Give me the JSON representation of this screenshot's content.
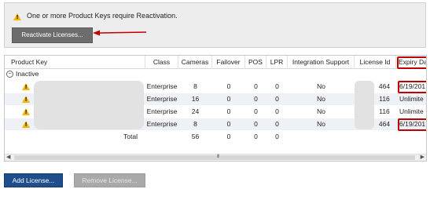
{
  "notice": {
    "message": "One or more Product Keys require Reactivation.",
    "reactivate_label": "Reactivate Licenses..."
  },
  "grid": {
    "columns": [
      "Product Key",
      "Class",
      "Cameras",
      "Failover",
      "POS",
      "LPR",
      "Integration Support",
      "License Id",
      "Expiry Da"
    ],
    "group_label": "Inactive",
    "rows": [
      {
        "class": "Enterprise",
        "cameras": "8",
        "failover": "0",
        "pos": "0",
        "lpr": "0",
        "integration": "No",
        "license_id": "464",
        "expiry": "6/19/201"
      },
      {
        "class": "Enterprise",
        "cameras": "16",
        "failover": "0",
        "pos": "0",
        "lpr": "0",
        "integration": "No",
        "license_id": "116",
        "expiry": "Unlimite"
      },
      {
        "class": "Enterprise",
        "cameras": "24",
        "failover": "0",
        "pos": "0",
        "lpr": "0",
        "integration": "No",
        "license_id": "116",
        "expiry": "Unlimite"
      },
      {
        "class": "Enterprise",
        "cameras": "8",
        "failover": "0",
        "pos": "0",
        "lpr": "0",
        "integration": "No",
        "license_id": "464",
        "expiry": "6/19/201"
      }
    ],
    "total": {
      "label": "Total",
      "cameras": "56",
      "failover": "0",
      "pos": "0",
      "lpr": "0"
    },
    "scroll_grip": "III"
  },
  "buttons": {
    "add_label": "Add License...",
    "remove_label": "Remove License..."
  },
  "colors": {
    "warning": "#f2b705",
    "highlight": "#c00000",
    "primary_button": "#1f4e8c",
    "reactivate_button": "#6d6d6d",
    "disabled_button": "#a9a9a9"
  },
  "icons": {
    "warning": "warning-icon",
    "expander": "collapse-icon",
    "scroll_left": "scroll-left-icon",
    "scroll_right": "scroll-right-icon"
  }
}
